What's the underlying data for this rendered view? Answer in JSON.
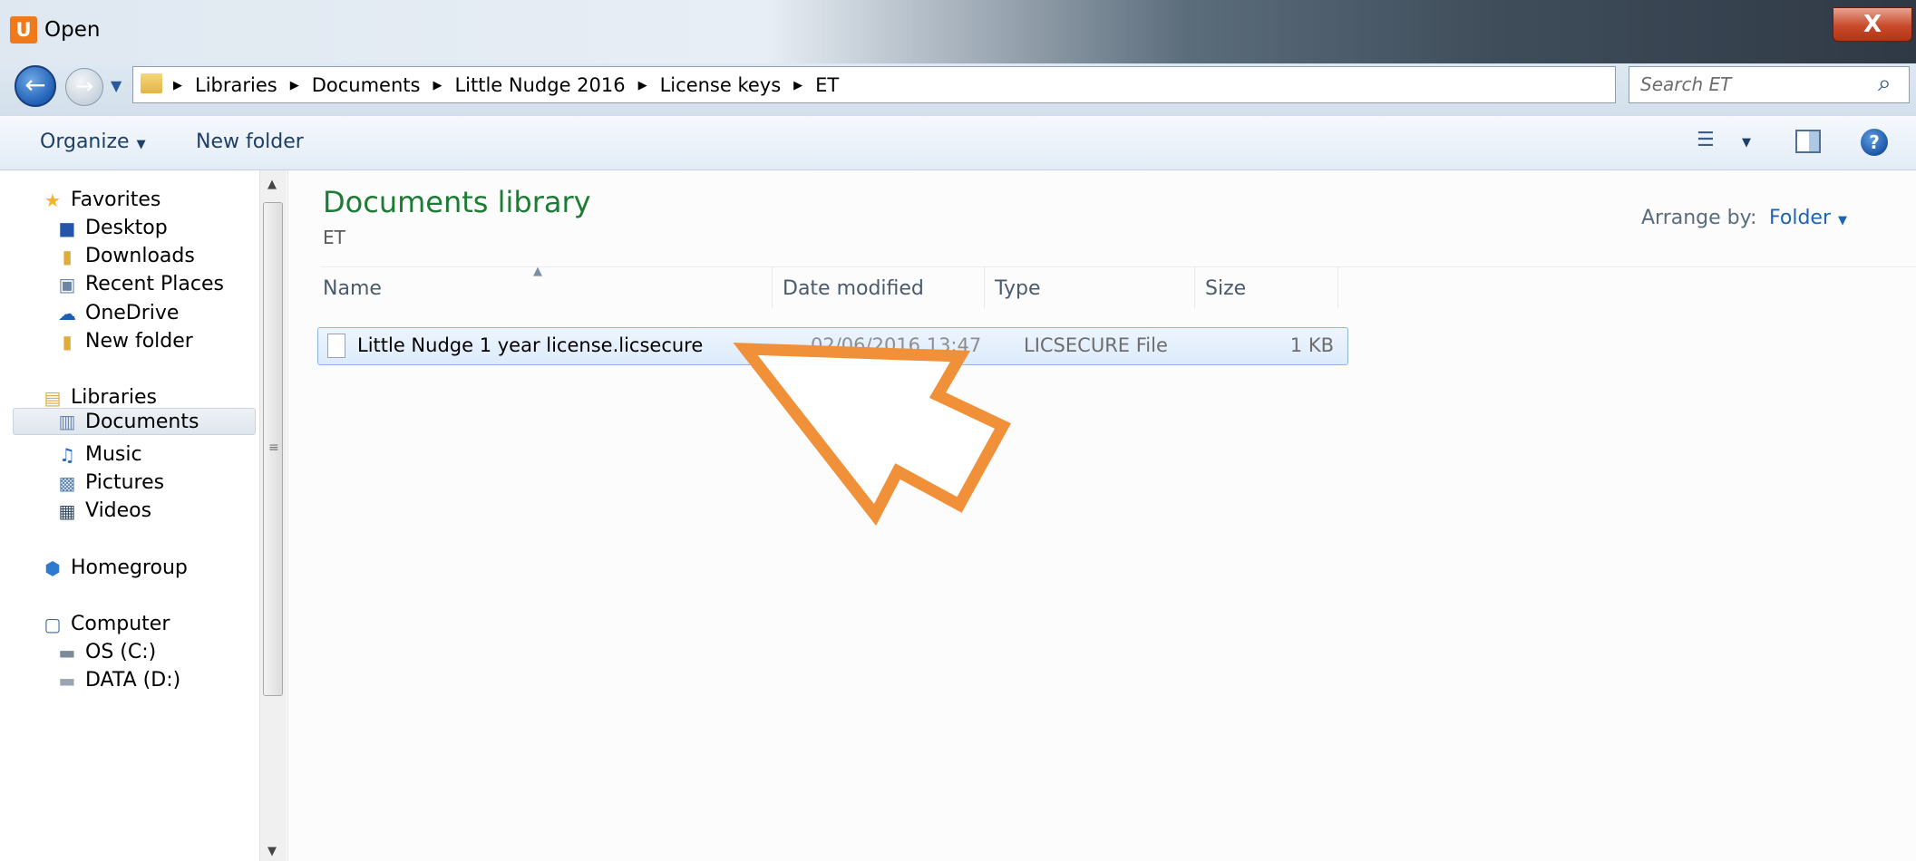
{
  "window": {
    "title": "Open",
    "close_label": "X",
    "app_icon_glyph": "U"
  },
  "address": {
    "crumbs": [
      "Libraries",
      "Documents",
      "Little Nudge 2016",
      "License keys",
      "ET"
    ],
    "search_placeholder": "Search ET"
  },
  "toolbar": {
    "organize_label": "Organize",
    "new_folder_label": "New folder"
  },
  "nav": {
    "favorites": {
      "label": "Favorites",
      "items": [
        "Desktop",
        "Downloads",
        "Recent Places",
        "OneDrive",
        "New folder"
      ]
    },
    "libraries": {
      "label": "Libraries",
      "items": [
        "Documents",
        "Music",
        "Pictures",
        "Videos"
      ]
    },
    "homegroup": {
      "label": "Homegroup"
    },
    "computer": {
      "label": "Computer",
      "items": [
        "OS (C:)",
        "DATA (D:)"
      ]
    }
  },
  "content": {
    "title": "Documents library",
    "subtitle": "ET",
    "arrange_label": "Arrange by:",
    "arrange_value": "Folder",
    "columns": [
      "Name",
      "Date modified",
      "Type",
      "Size"
    ],
    "rows": [
      {
        "name": "Little Nudge 1 year license.licsecure",
        "date": "02/06/2016 13:47",
        "type": "LICSECURE File",
        "size": "1 KB"
      }
    ]
  },
  "colors": {
    "accent": "#1e64b4",
    "title_green": "#1d7c34",
    "annotation_orange": "#f0913a"
  }
}
